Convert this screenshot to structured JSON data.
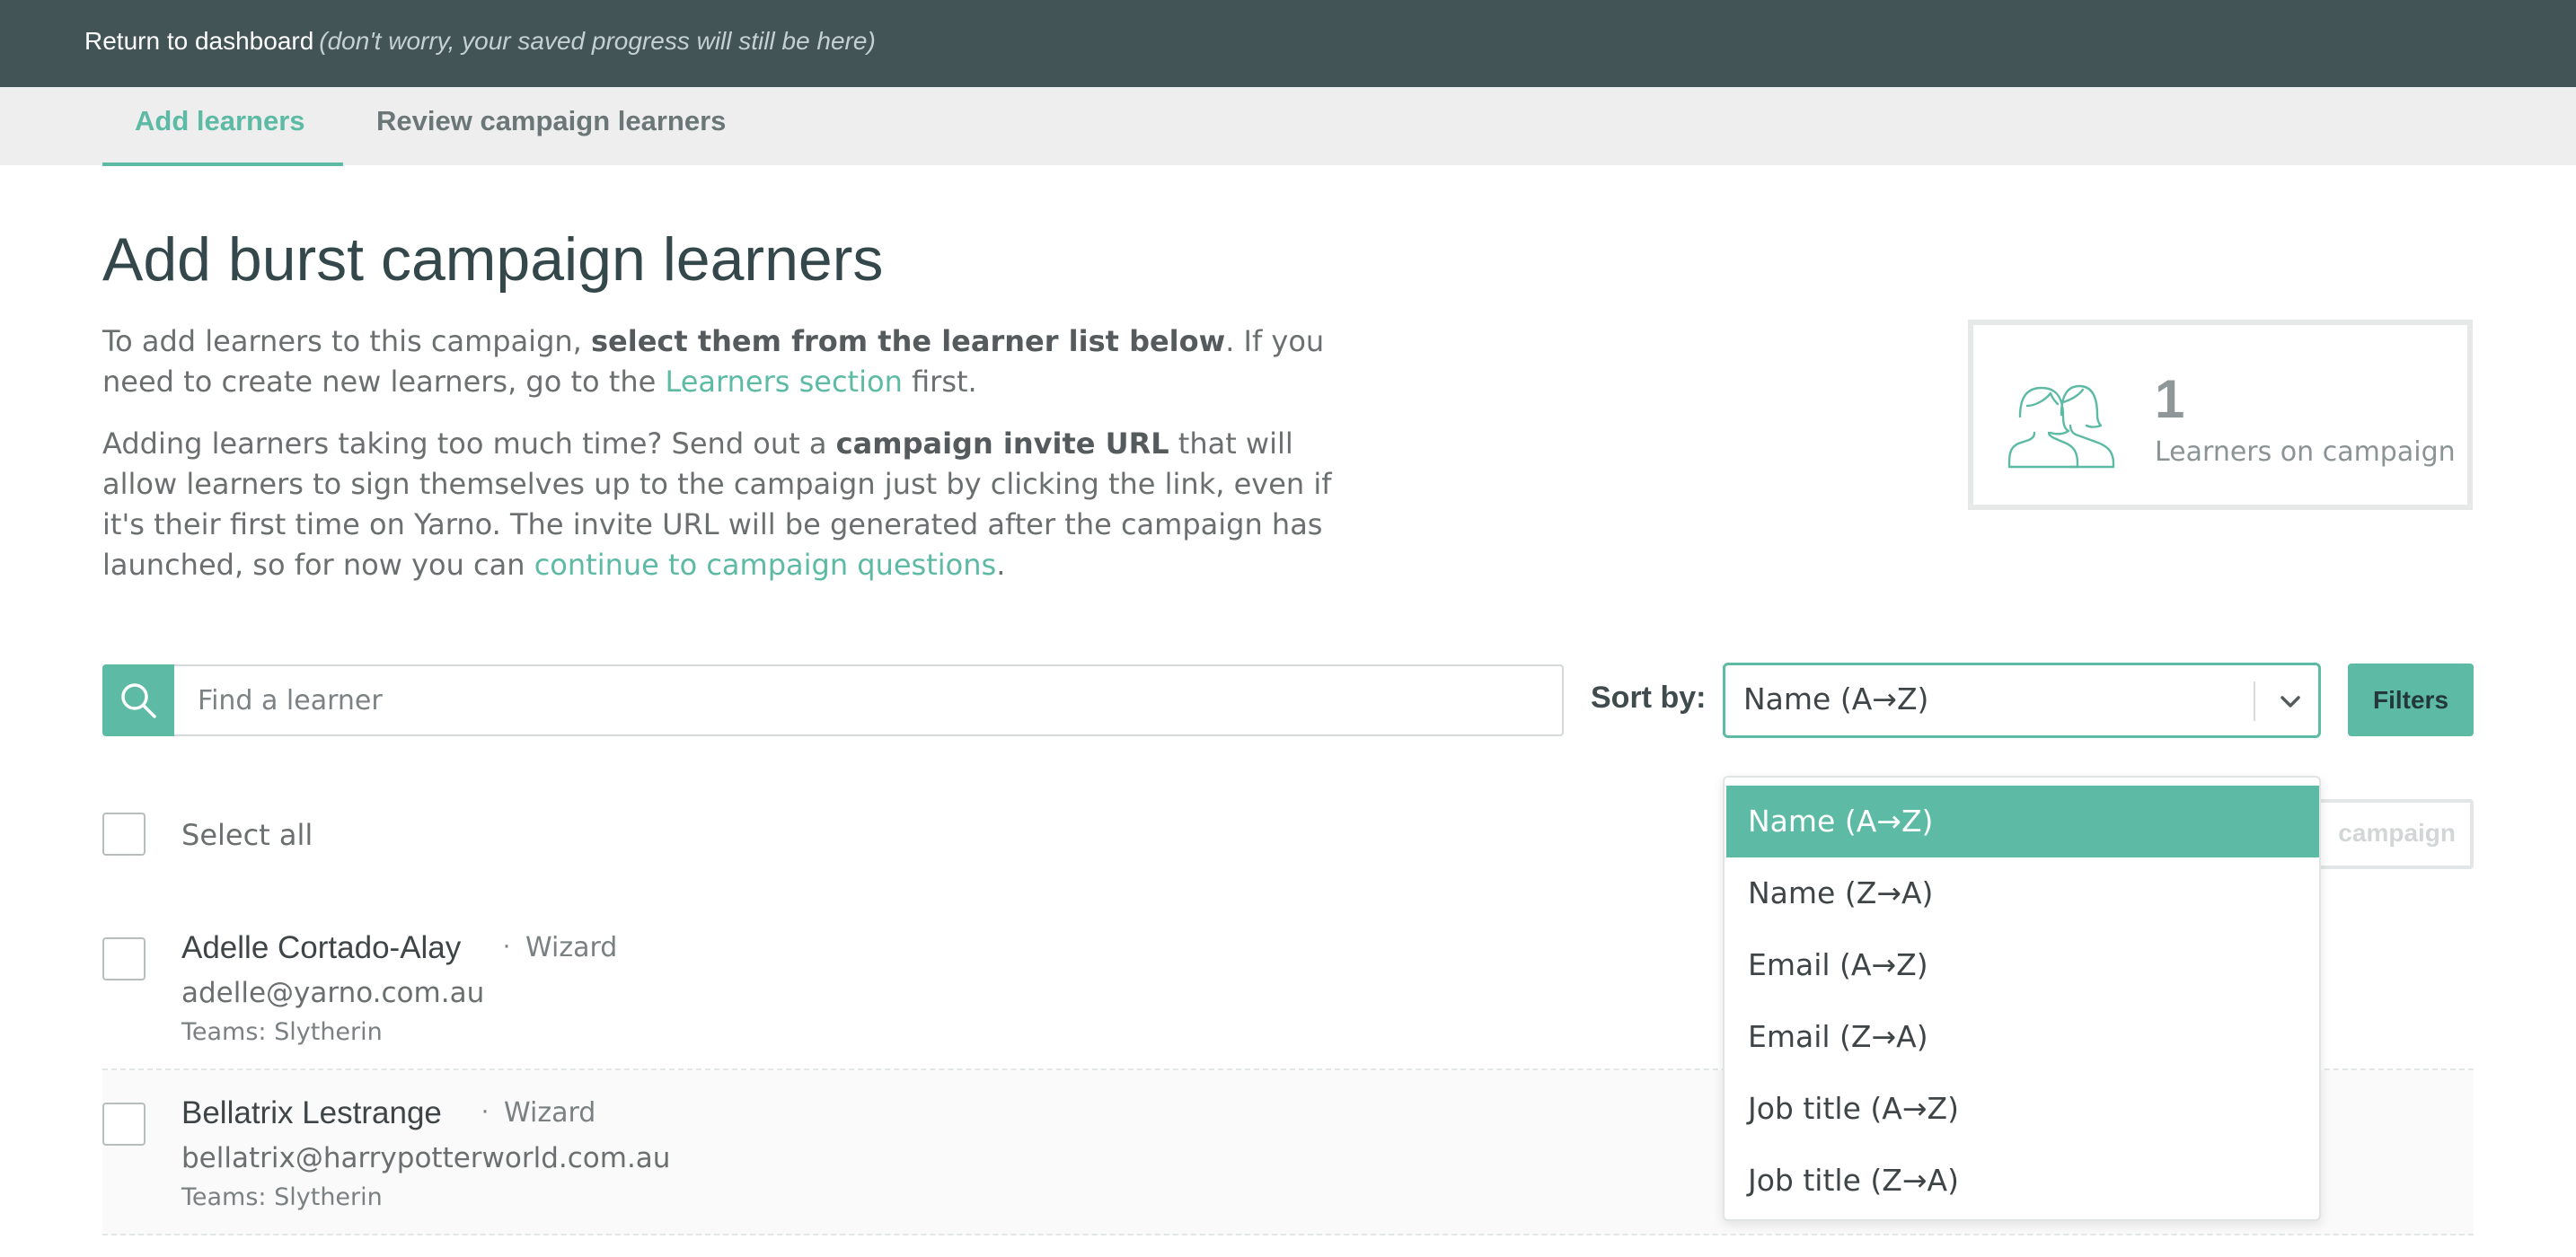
{
  "topbar": {
    "return_label": "Return to dashboard",
    "return_note": "(don't worry, your saved progress will still be here)"
  },
  "tabs": [
    {
      "label": "Add learners",
      "active": true
    },
    {
      "label": "Review campaign learners",
      "active": false
    }
  ],
  "page": {
    "title": "Add burst campaign learners",
    "intro": {
      "t1": "To add learners to this campaign, ",
      "b1": "select them from the learner list below",
      "t2": ". If you need to create new learners, go to the ",
      "link1": "Learners section",
      "t3": " first."
    },
    "invite": {
      "t1": "Adding learners taking too much time? Send out a ",
      "b1": "campaign invite URL",
      "t2": " that will allow learners to sign themselves up to the campaign just by clicking the link, even if it's their first time on Yarno. The invite URL will be generated after the campaign has launched, so for now you can ",
      "link1": "continue to campaign questions",
      "t3": "."
    }
  },
  "learner_count": {
    "value": "1",
    "label": "Learners on campaign"
  },
  "search": {
    "placeholder": "Find a learner"
  },
  "sort": {
    "label": "Sort by:",
    "selected": "Name (A→Z)",
    "options": [
      "Name (A→Z)",
      "Name (Z→A)",
      "Email (A→Z)",
      "Email (Z→A)",
      "Job title (A→Z)",
      "Job title (Z→A)"
    ]
  },
  "filters_label": "Filters",
  "select_all_label": "Select all",
  "add_button_label": "campaign",
  "learners": [
    {
      "name": "Adelle Cortado-Alay",
      "role": "Wizard",
      "email": "adelle@yarno.com.au",
      "teams": "Teams: Slytherin"
    },
    {
      "name": "Bellatrix Lestrange",
      "role": "Wizard",
      "email": "bellatrix@harrypotterworld.com.au",
      "teams": "Teams: Slytherin"
    }
  ],
  "separator": "·",
  "colors": {
    "accent": "#5dbaa4",
    "topbar": "#435457",
    "tabbar": "#eeeeee",
    "title": "#34474a"
  }
}
